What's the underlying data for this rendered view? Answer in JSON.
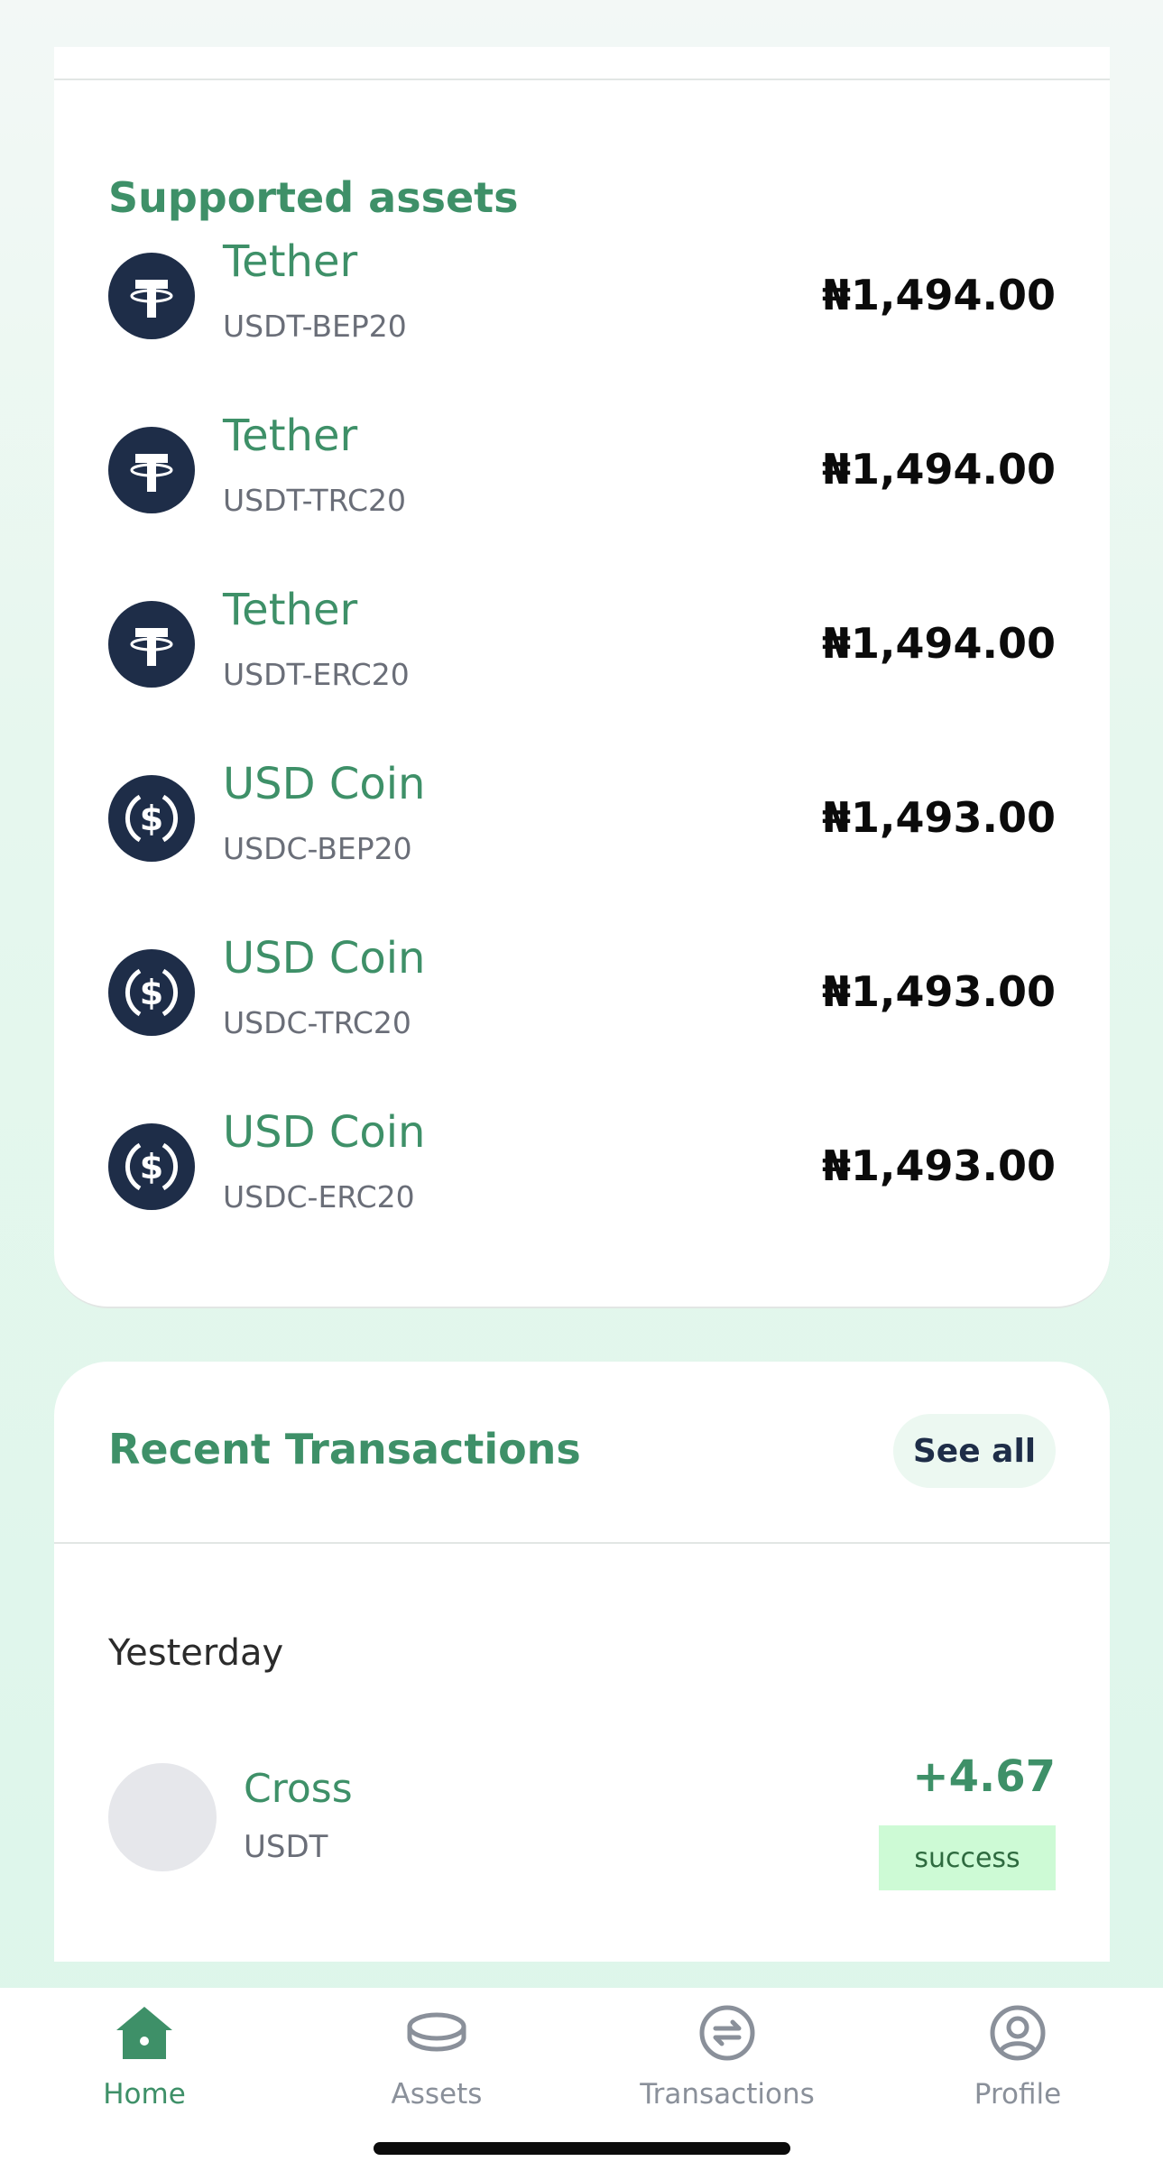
{
  "supported_assets": {
    "title": "Supported assets",
    "items": [
      {
        "name": "Tether",
        "code": "USDT-BEP20",
        "price": "₦1,494.00",
        "icon": "tether-icon"
      },
      {
        "name": "Tether",
        "code": "USDT-TRC20",
        "price": "₦1,494.00",
        "icon": "tether-icon"
      },
      {
        "name": "Tether",
        "code": "USDT-ERC20",
        "price": "₦1,494.00",
        "icon": "tether-icon"
      },
      {
        "name": "USD Coin",
        "code": "USDC-BEP20",
        "price": "₦1,493.00",
        "icon": "usd-coin-icon"
      },
      {
        "name": "USD Coin",
        "code": "USDC-TRC20",
        "price": "₦1,493.00",
        "icon": "usd-coin-icon"
      },
      {
        "name": "USD Coin",
        "code": "USDC-ERC20",
        "price": "₦1,493.00",
        "icon": "usd-coin-icon"
      }
    ]
  },
  "recent_transactions": {
    "title": "Recent Transactions",
    "see_all_label": "See all",
    "groups": [
      {
        "label": "Yesterday",
        "items": [
          {
            "name": "Cross",
            "asset": "USDT",
            "amount": "+4.67",
            "status": "success"
          }
        ]
      }
    ]
  },
  "bottom_nav": {
    "items": [
      {
        "label": "Home",
        "icon": "home-icon",
        "active": true
      },
      {
        "label": "Assets",
        "icon": "coins-icon",
        "active": false
      },
      {
        "label": "Transactions",
        "icon": "exchange-icon",
        "active": false
      },
      {
        "label": "Profile",
        "icon": "user-circle-icon",
        "active": false
      }
    ]
  },
  "colors": {
    "accent": "#3e9068",
    "icon_bg": "#1e2d48",
    "status_bg": "#cdfad5"
  }
}
